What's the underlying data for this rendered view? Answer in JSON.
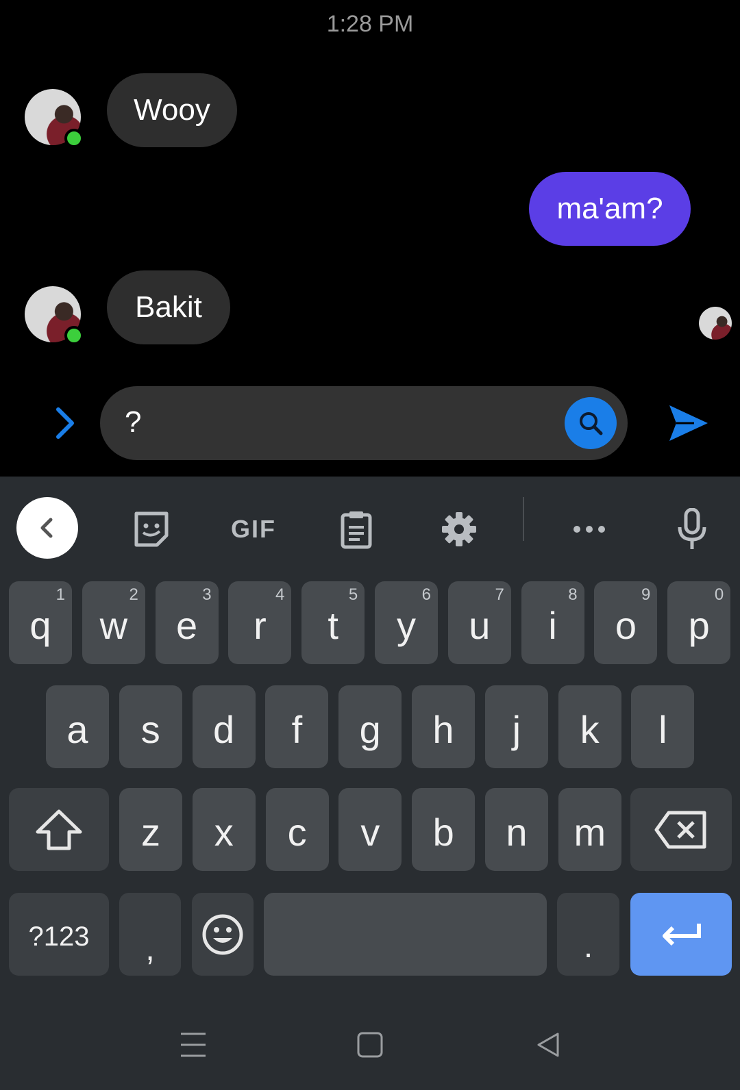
{
  "status": {
    "time": "1:28 PM"
  },
  "messages": [
    {
      "text": "Wooy",
      "from": "other"
    },
    {
      "text": "ma'am?",
      "from": "me"
    },
    {
      "text": "Bakit",
      "from": "other"
    }
  ],
  "composer": {
    "value": "?",
    "expand_icon": "chevron-right-icon",
    "search_icon": "search-icon",
    "send_icon": "send-icon"
  },
  "keyboard": {
    "toolbar": {
      "back_icon": "chevron-left-icon",
      "sticker_icon": "sticker-icon",
      "gif_label": "GIF",
      "clipboard_icon": "clipboard-icon",
      "settings_icon": "gear-icon",
      "more_icon": "more-icon",
      "mic_icon": "mic-icon"
    },
    "row1": [
      {
        "k": "q",
        "h": "1"
      },
      {
        "k": "w",
        "h": "2"
      },
      {
        "k": "e",
        "h": "3"
      },
      {
        "k": "r",
        "h": "4"
      },
      {
        "k": "t",
        "h": "5"
      },
      {
        "k": "y",
        "h": "6"
      },
      {
        "k": "u",
        "h": "7"
      },
      {
        "k": "i",
        "h": "8"
      },
      {
        "k": "o",
        "h": "9"
      },
      {
        "k": "p",
        "h": "0"
      }
    ],
    "row2": [
      "a",
      "s",
      "d",
      "f",
      "g",
      "h",
      "j",
      "k",
      "l"
    ],
    "row3": [
      "z",
      "x",
      "c",
      "v",
      "b",
      "n",
      "m"
    ],
    "symbols_label": "?123",
    "comma_label": ",",
    "period_label": "."
  },
  "colors": {
    "my_bubble": "#5b3ee6",
    "their_bubble": "#2e2e2e",
    "accent": "#1a7ee8",
    "enter_key": "#5f96f2",
    "online": "#3ccf3c"
  }
}
